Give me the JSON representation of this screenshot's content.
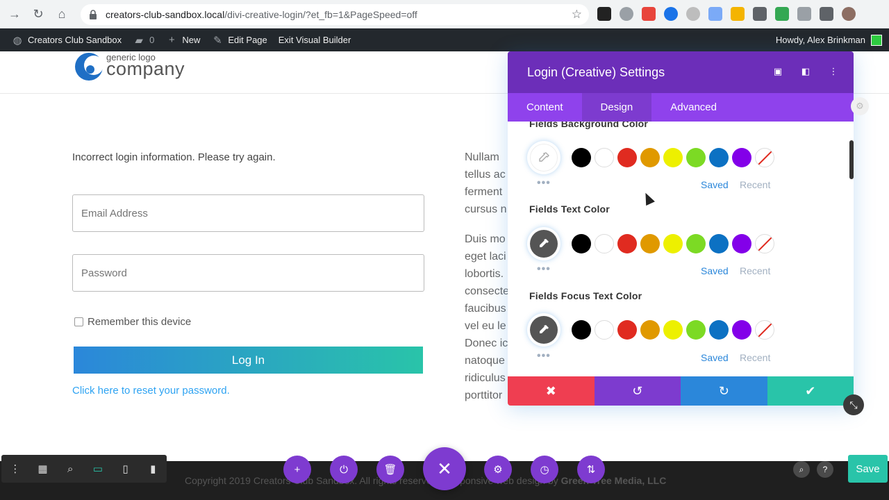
{
  "browser": {
    "url_host": "creators-club-sandbox.local",
    "url_path": "/divi-creative-login/?et_fb=1&PageSpeed=off"
  },
  "admin_bar": {
    "site_name": "Creators Club Sandbox",
    "comments_count": "0",
    "new_label": "New",
    "edit_page_label": "Edit Page",
    "exit_builder_label": "Exit Visual Builder",
    "howdy": "Howdy, Alex Brinkman"
  },
  "logo": {
    "small": "generic logo",
    "big": "company"
  },
  "login": {
    "error_message": "Incorrect login information. Please try again.",
    "email_placeholder": "Email Address",
    "password_placeholder": "Password",
    "remember_label": "Remember this device",
    "login_button": "Log In",
    "reset_link": "Click here to reset your password."
  },
  "lorem_lines_1": [
    "Nullam",
    "tellus ac",
    "ferment",
    "cursus n"
  ],
  "lorem_lines_2": [
    "Duis mo",
    "eget laci",
    "lobortis.",
    "consecte",
    "faucibus",
    "vel eu le",
    "Donec ic",
    "natoque",
    "ridiculus",
    "porttitor"
  ],
  "modal": {
    "title": "Login (Creative) Settings",
    "tabs": [
      "Content",
      "Design",
      "Advanced"
    ],
    "active_tab": "Design",
    "options": [
      {
        "label": "Fields Background Color",
        "picker_color": "#ffffff"
      },
      {
        "label": "Fields Text Color",
        "picker_color": "#555555"
      },
      {
        "label": "Fields Focus Text Color",
        "picker_color": "#555555"
      }
    ],
    "swatches": [
      "#000000",
      "#ffffff",
      "#e02b20",
      "#e09900",
      "#edf000",
      "#7cda24",
      "#0c71c3",
      "#8300e9",
      "none"
    ],
    "saved_label": "Saved",
    "recent_label": "Recent",
    "colors": {
      "head": "#6c2eb9",
      "tabs": "#8f42ec",
      "cancel": "#ef3e51",
      "undo": "#7d3bcf",
      "redo": "#2b87da",
      "save": "#29c4a9"
    }
  },
  "footer": {
    "text": "Copyright 2019 Creators Club Sandbox. All rights reserved. Responsive web design by ",
    "brand": "Green Tree Media, LLC"
  },
  "save_button": "Save"
}
